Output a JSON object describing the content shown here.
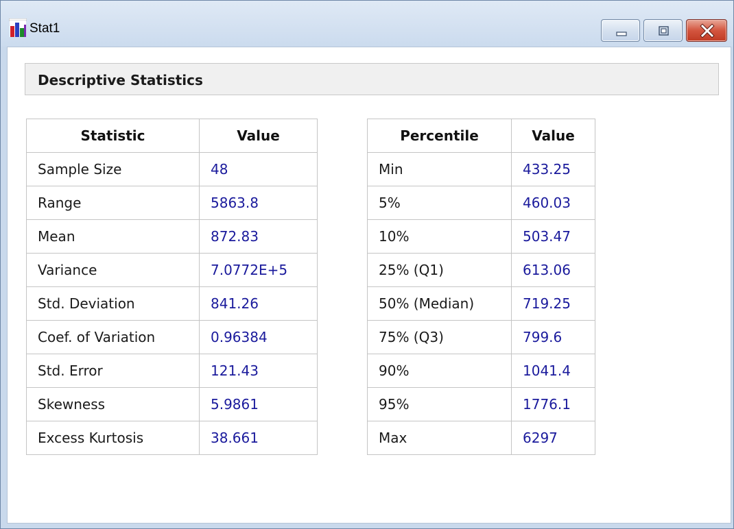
{
  "window": {
    "title": "Stat1"
  },
  "section": {
    "title": "Descriptive Statistics"
  },
  "statistics_table": {
    "headers": [
      "Statistic",
      "Value"
    ],
    "rows": [
      {
        "label": "Sample Size",
        "value": "48"
      },
      {
        "label": "Range",
        "value": "5863.8"
      },
      {
        "label": "Mean",
        "value": "872.83"
      },
      {
        "label": "Variance",
        "value": "7.0772E+5"
      },
      {
        "label": "Std. Deviation",
        "value": "841.26"
      },
      {
        "label": "Coef. of Variation",
        "value": "0.96384"
      },
      {
        "label": "Std. Error",
        "value": "121.43"
      },
      {
        "label": "Skewness",
        "value": "5.9861"
      },
      {
        "label": "Excess Kurtosis",
        "value": "38.661"
      }
    ]
  },
  "percentile_table": {
    "headers": [
      "Percentile",
      "Value"
    ],
    "rows": [
      {
        "label": "Min",
        "value": "433.25"
      },
      {
        "label": "5%",
        "value": "460.03"
      },
      {
        "label": "10%",
        "value": "503.47"
      },
      {
        "label": "25% (Q1)",
        "value": "613.06"
      },
      {
        "label": "50% (Median)",
        "value": "719.25"
      },
      {
        "label": "75% (Q3)",
        "value": "799.6"
      },
      {
        "label": "90%",
        "value": "1041.4"
      },
      {
        "label": "95%",
        "value": "1776.1"
      },
      {
        "label": "Max",
        "value": "6297"
      }
    ]
  },
  "colors": {
    "value_text": "#1a1a9c",
    "close_button": "#c9452f",
    "titlebar": "#cbdbee"
  },
  "icons": {
    "app": "bar-chart-icon",
    "minimize": "minimize-icon",
    "maximize": "maximize-icon",
    "close": "close-icon"
  }
}
